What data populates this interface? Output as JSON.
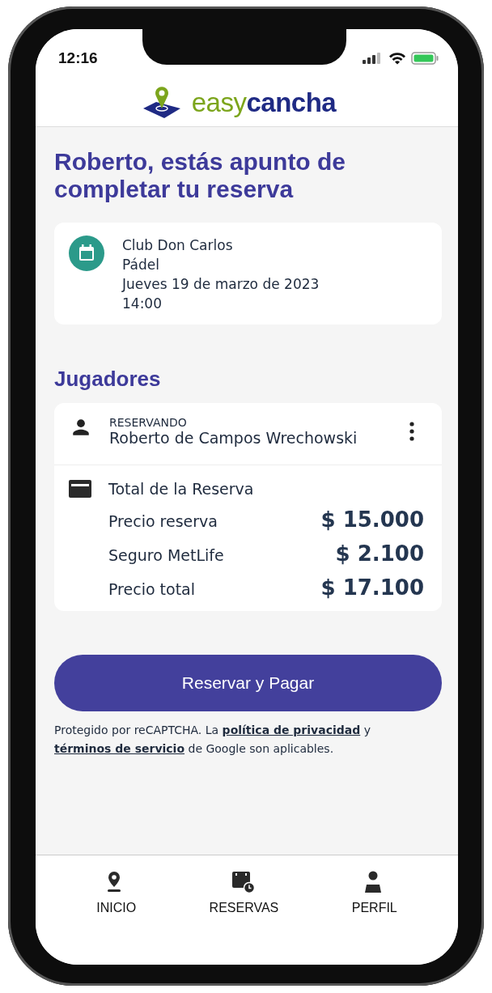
{
  "status_bar": {
    "time": "12:16"
  },
  "header": {
    "logo": {
      "first": "easy",
      "second": "cancha"
    }
  },
  "title": "Roberto, estás apunto de completar tu reserva",
  "booking": {
    "club": "Club Don Carlos",
    "sport": "Pádel",
    "date": "Jueves 19 de marzo de 2023",
    "time": "14:00"
  },
  "players": {
    "heading": "Jugadores",
    "role": "RESERVANDO",
    "name": "Roberto de Campos Wrechowski"
  },
  "total": {
    "heading": "Total de la Reserva",
    "lines": [
      {
        "label": "Precio reserva",
        "amount": "$ 15.000"
      },
      {
        "label": "Seguro MetLife",
        "amount": "$ 2.100"
      },
      {
        "label": "Precio total",
        "amount": "$ 17.100"
      }
    ]
  },
  "pay_button": "Reservar y Pagar",
  "notice": [
    {
      "kind": "text",
      "text": "Protegido por reCAPTCHA. La "
    },
    {
      "kind": "link",
      "text": "política de privacidad"
    },
    {
      "kind": "text",
      "text": " y "
    },
    {
      "kind": "link",
      "text": "términos de servicio"
    },
    {
      "kind": "text",
      "text": " de Google son aplicables."
    }
  ],
  "nav": [
    {
      "kind": "pin",
      "label": "INICIO"
    },
    {
      "kind": "calendar",
      "label": "RESERVAS"
    },
    {
      "kind": "person",
      "label": "PERFIL"
    }
  ]
}
